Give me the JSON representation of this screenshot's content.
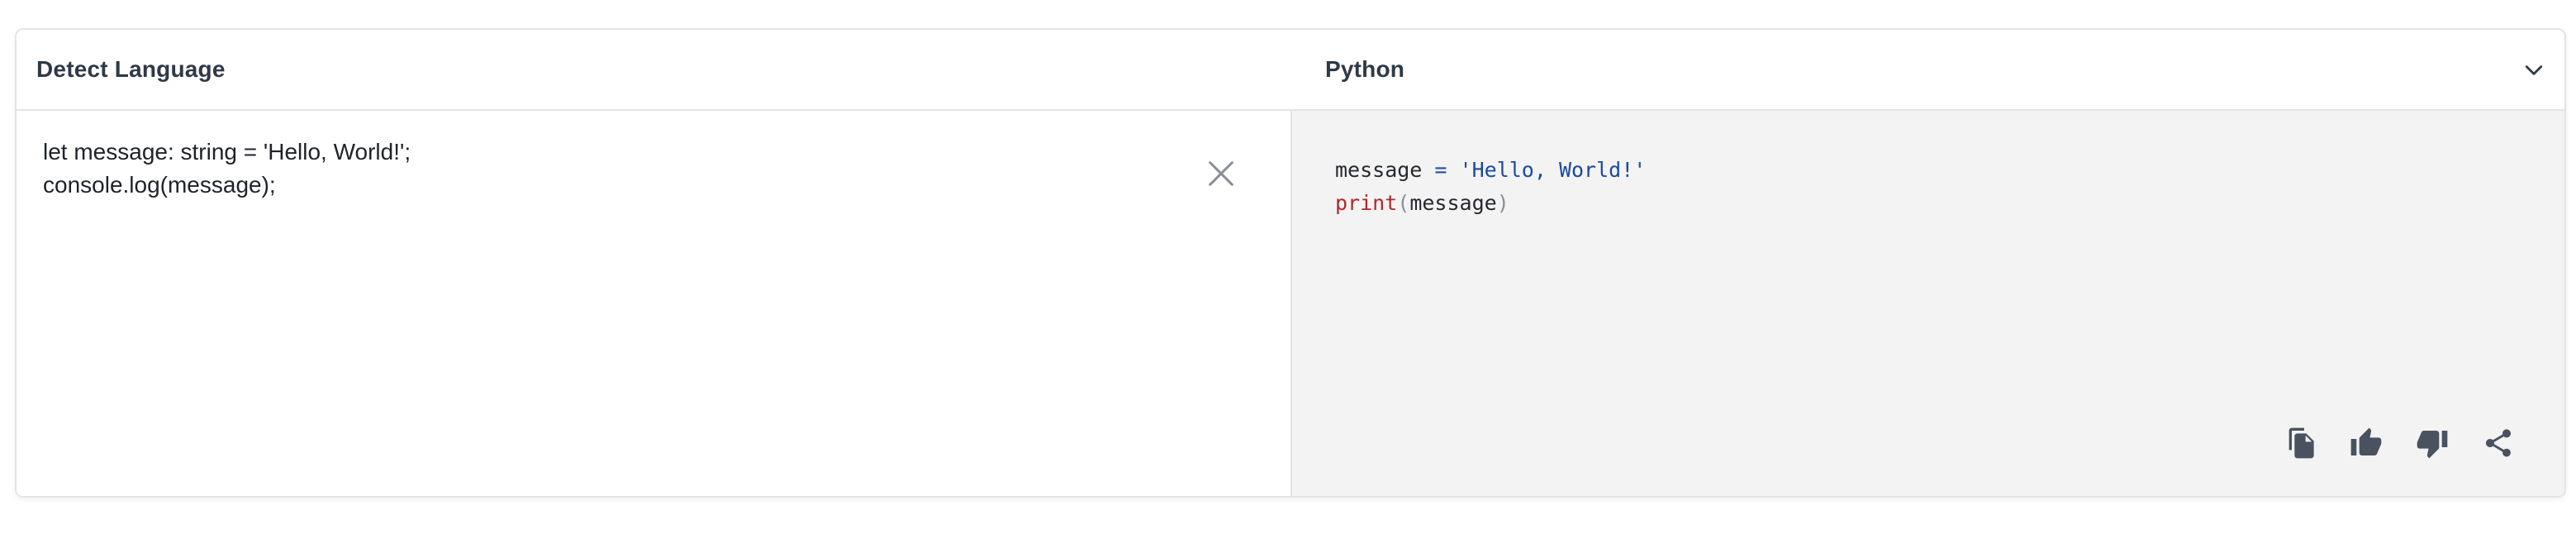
{
  "header": {
    "source_language": "Detect Language",
    "target_language": "Python"
  },
  "source": {
    "text": "let message: string = 'Hello, World!';\nconsole.log(message);"
  },
  "output": {
    "line1": {
      "ident": "message",
      "op": "=",
      "string": "'Hello, World!'"
    },
    "line2": {
      "fn": "print",
      "open": "(",
      "arg": "message",
      "close": ")"
    }
  },
  "icons": {
    "chevron": "chevron-down-icon",
    "clear": "close-icon",
    "copy": "copy-icon",
    "like": "thumbs-up-icon",
    "dislike": "thumbs-down-icon",
    "share": "share-icon"
  },
  "colors": {
    "border": "#e3e4e6",
    "output_bg": "#f3f3f3",
    "keyword_fn": "#b3262c",
    "string": "#1c4aa0"
  }
}
